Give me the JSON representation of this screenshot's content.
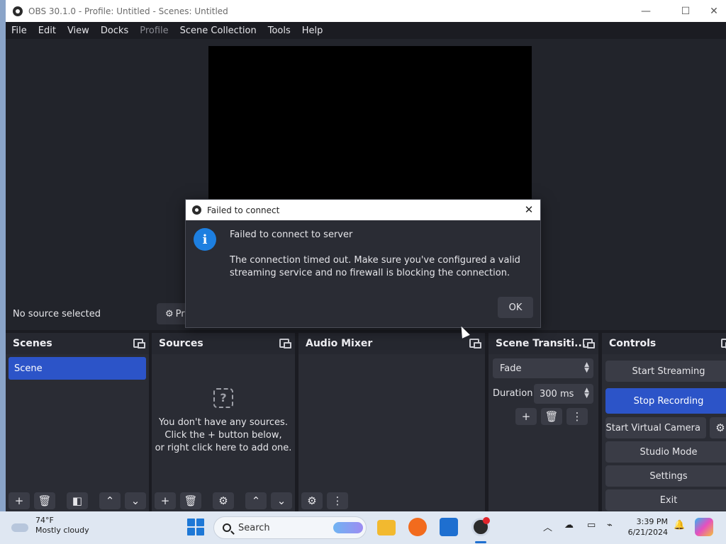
{
  "window": {
    "title": "OBS 30.1.0 - Profile: Untitled - Scenes: Untitled",
    "minimize_glyph": "—",
    "maximize_glyph": "☐",
    "close_glyph": "✕"
  },
  "menu": [
    "File",
    "Edit",
    "View",
    "Docks",
    "Profile",
    "Scene Collection",
    "Tools",
    "Help"
  ],
  "context_bar": {
    "no_source": "No source selected",
    "properties_label": "Pr"
  },
  "docks": {
    "scenes": {
      "title": "Scenes",
      "items": [
        "Scene"
      ]
    },
    "sources": {
      "title": "Sources",
      "empty_line1": "You don't have any sources.",
      "empty_line2": "Click the + button below,",
      "empty_line3": "or right click here to add one."
    },
    "audio_mixer": {
      "title": "Audio Mixer"
    },
    "transitions": {
      "title": "Scene Transiti...",
      "selected": "Fade",
      "duration_label": "Duration",
      "duration_value": "300 ms"
    },
    "controls": {
      "title": "Controls",
      "start_streaming": "Start Streaming",
      "stop_recording": "Stop Recording",
      "start_virtual_camera": "Start Virtual Camera",
      "studio_mode": "Studio Mode",
      "settings": "Settings",
      "exit": "Exit"
    }
  },
  "dialog": {
    "title": "Failed to connect",
    "heading": "Failed to connect to server",
    "body_line1": "The connection timed out. Make sure you've configured a valid",
    "body_line2": "streaming service and no firewall is blocking the connection.",
    "ok": "OK"
  },
  "taskbar": {
    "temperature": "74°F",
    "condition": "Mostly cloudy",
    "search": "Search",
    "time": "3:39 PM",
    "date": "6/21/2024"
  },
  "colors": {
    "accent": "#2c54c8",
    "info_icon": "#1d7fe0",
    "window_bg": "#1b1c22",
    "dock_bg": "#2a2c34"
  }
}
